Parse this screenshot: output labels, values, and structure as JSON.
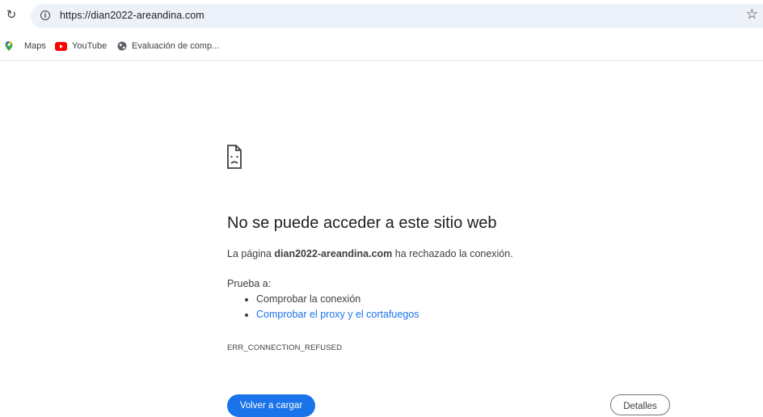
{
  "toolbar": {
    "url": "https://dian2022-areandina.com",
    "reload_icon": "reload-icon",
    "site_info_icon": "info-icon",
    "bookmark_star_icon": "star-icon"
  },
  "bookmarks": [
    {
      "label": "Maps",
      "icon": "maps-icon"
    },
    {
      "label": "YouTube",
      "icon": "youtube-icon"
    },
    {
      "label": "Evaluación de comp...",
      "icon": "globe-icon"
    }
  ],
  "error": {
    "icon": "sad-page-icon",
    "title": "No se puede acceder a este sitio web",
    "desc_prefix": "La página ",
    "domain": "dian2022-areandina.com",
    "desc_suffix": " ha rechazado la conexión.",
    "try_label": "Prueba a:",
    "suggestions": [
      "Comprobar la conexión",
      "Comprobar el proxy y el cortafuegos"
    ],
    "code": "ERR_CONNECTION_REFUSED"
  },
  "buttons": {
    "reload": "Volver a cargar",
    "details": "Detalles"
  },
  "colors": {
    "accent": "#1a73e8",
    "omnibox_bg": "#edf2fa",
    "text": "#202124",
    "youtube_red": "#ff0000"
  }
}
